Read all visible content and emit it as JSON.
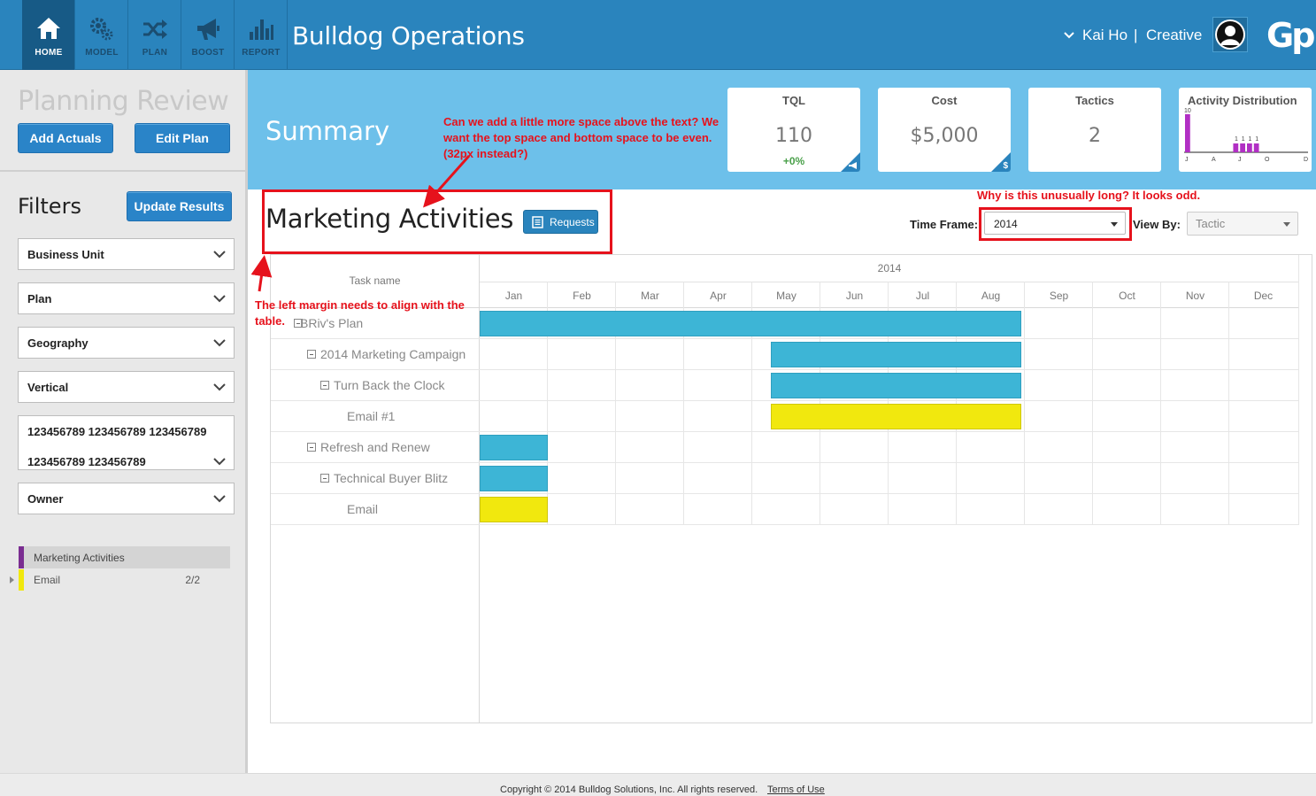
{
  "app": {
    "title": "Bulldog Operations",
    "logo": "Gp",
    "nav": [
      {
        "label": "HOME",
        "icon": "home-icon",
        "active": true
      },
      {
        "label": "MODEL",
        "icon": "gears-icon",
        "active": false
      },
      {
        "label": "PLAN",
        "icon": "shuffle-icon",
        "active": false
      },
      {
        "label": "BOOST",
        "icon": "megaphone-icon",
        "active": false
      },
      {
        "label": "REPORT",
        "icon": "bar-chart-icon",
        "active": false
      }
    ],
    "user": {
      "name": "Kai Ho",
      "separator": "|",
      "role": "Creative"
    }
  },
  "sidebar": {
    "title": "Planning Review",
    "add_actuals": "Add Actuals",
    "edit_plan": "Edit Plan",
    "filters_title": "Filters",
    "update_results": "Update Results",
    "filters": [
      {
        "label": "Business Unit"
      },
      {
        "label": "Plan"
      },
      {
        "label": "Geography"
      },
      {
        "label": "Vertical"
      },
      {
        "label_line1": "123456789 123456789 123456789",
        "label_line2": "123456789 123456789"
      },
      {
        "label": "Owner"
      }
    ],
    "legend": {
      "header": "Marketing Activities",
      "rows": [
        {
          "label": "Email",
          "count": "2/2"
        }
      ]
    }
  },
  "summary": {
    "title": "Summary",
    "cards": [
      {
        "title": "TQL",
        "value": "110",
        "delta": "+0%",
        "corner_glyph": "megaphone"
      },
      {
        "title": "Cost",
        "value": "$5,000",
        "corner_glyph": "$"
      },
      {
        "title": "Tactics",
        "value": "2"
      }
    ],
    "distribution": {
      "title": "Activity Distribution",
      "max_label": "10",
      "bars": [
        10,
        0,
        0,
        0,
        0,
        0,
        0,
        1,
        1,
        1,
        1,
        0,
        0,
        0,
        0,
        0,
        0,
        0
      ],
      "bar_labels": [
        "",
        "",
        "",
        "",
        "",
        "",
        "",
        "1",
        "1",
        "1",
        "1",
        "",
        "",
        "",
        "",
        "",
        "",
        ""
      ],
      "axis_labels": [
        "J",
        "A",
        "J",
        "O",
        "D"
      ]
    }
  },
  "activities": {
    "title": "Marketing Activities",
    "requests_label": "Requests",
    "timeframe_label": "Time Frame:",
    "timeframe_value": "2014",
    "viewby_label": "View By:",
    "viewby_value": "Tactic"
  },
  "gantt": {
    "task_header": "Task name",
    "year": "2014",
    "months": [
      "Jan",
      "Feb",
      "Mar",
      "Apr",
      "May",
      "Jun",
      "Jul",
      "Aug",
      "Sep",
      "Oct",
      "Nov",
      "Dec"
    ],
    "tasks": [
      {
        "name": "BRiv's Plan",
        "level": 0,
        "collapsible": true,
        "start_month": 0,
        "end_month": 7.95,
        "color": "blue"
      },
      {
        "name": "2014 Marketing Campaign",
        "level": 1,
        "collapsible": true,
        "start_month": 4.27,
        "end_month": 7.95,
        "color": "blue"
      },
      {
        "name": "Turn Back the Clock",
        "level": 2,
        "collapsible": true,
        "start_month": 4.27,
        "end_month": 7.95,
        "color": "blue"
      },
      {
        "name": "Email #1",
        "level": 3,
        "collapsible": false,
        "start_month": 4.27,
        "end_month": 7.95,
        "color": "yellow"
      },
      {
        "name": "Refresh and Renew",
        "level": 1,
        "collapsible": true,
        "start_month": 0,
        "end_month": 1,
        "color": "blue"
      },
      {
        "name": "Technical Buyer Blitz",
        "level": 2,
        "collapsible": true,
        "start_month": 0,
        "end_month": 1,
        "color": "blue"
      },
      {
        "name": "Email",
        "level": 3,
        "collapsible": false,
        "start_month": 0,
        "end_month": 1,
        "color": "yellow"
      }
    ]
  },
  "annotations": {
    "spacing_note": "Can we add a little more space above the text? We want the top space and bottom space to be even. (32px instead?)",
    "timeframe_note": "Why is this unusually long? It looks odd.",
    "margin_note": "The left margin needs to align with the table."
  },
  "footer": {
    "copyright": "Copyright © 2014 Bulldog Solutions, Inc. All rights reserved.",
    "terms": "Terms of Use"
  },
  "colors": {
    "topbar": "#2a84bd",
    "summary_band": "#6dc0ea",
    "bar_blue": "#3db5d6",
    "bar_yellow": "#f1e80e",
    "distribution_bar": "#b12fc4",
    "annotation_red": "#e6121c",
    "legend_purple": "#7a2d91"
  }
}
